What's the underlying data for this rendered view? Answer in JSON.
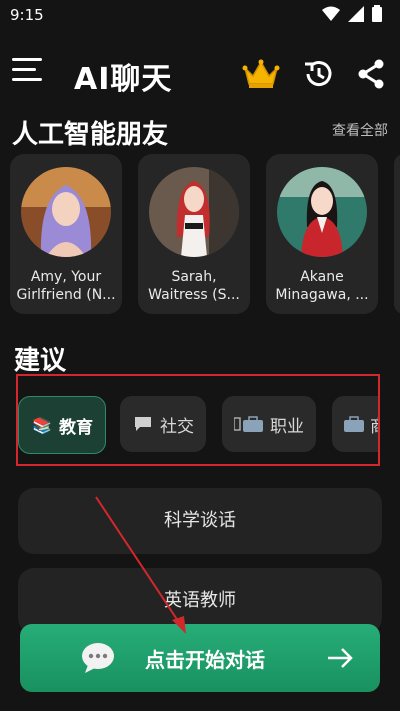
{
  "status": {
    "time": "9:15"
  },
  "app": {
    "title": "AI聊天"
  },
  "friends_section": {
    "title": "人工智能朋友",
    "see_all": "查看全部",
    "items": [
      {
        "line1": "Amy, Your",
        "line2": "Girlfriend (N..."
      },
      {
        "line1": "Sarah,",
        "line2": "Waitress (S..."
      },
      {
        "line1": "Akane",
        "line2": "Minagawa, ..."
      }
    ]
  },
  "suggest_section": {
    "title": "建议",
    "chips": [
      {
        "label": "教育",
        "icon": "books-icon"
      },
      {
        "label": "社交",
        "icon": "chat-bubble-icon"
      },
      {
        "label": "职业",
        "icon": "briefcase-icon"
      },
      {
        "label": "商",
        "icon": "briefcase-icon"
      }
    ],
    "items": [
      "科学谈话",
      "英语教师"
    ]
  },
  "cta": {
    "label": "点击开始对话"
  },
  "colors": {
    "accent": "#1fa26c",
    "highlight_box": "#d3282b"
  }
}
